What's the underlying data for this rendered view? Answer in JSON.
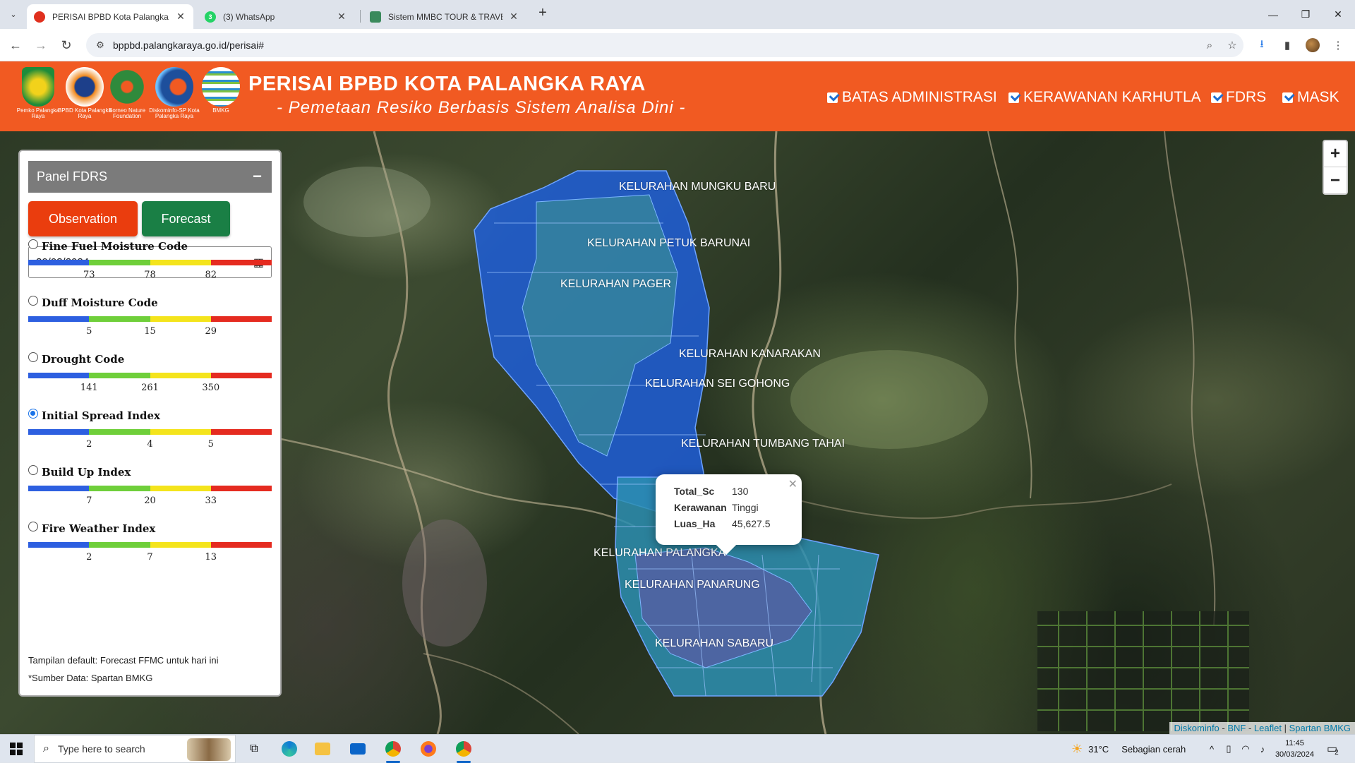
{
  "browser": {
    "tabs": [
      {
        "title": "PERISAI BPBD Kota Palangka Ra",
        "active": true
      },
      {
        "title": "(3) WhatsApp",
        "badge": "3",
        "active": false
      },
      {
        "title": "Sistem MMBC TOUR & TRAVEL",
        "active": false
      }
    ],
    "url": "bppbd.palangkaraya.go.id/perisai#"
  },
  "header": {
    "title": "PERISAI BPBD KOTA PALANGKA RAYA",
    "subtitle": "- Pemetaan Resiko Berbasis Sistem Analisa Dini -",
    "logos": [
      {
        "caption": "Pemko Palangka Raya",
        "color": "#1e8c3a"
      },
      {
        "caption": "BPBD Kota Palangka Raya",
        "color": "#f28a1f"
      },
      {
        "caption": "Borneo Nature Foundation",
        "color": "#2f8a3c"
      },
      {
        "caption": "Diskominfo-SP Kota Palangka Raya",
        "color": "#1d4f9c"
      },
      {
        "caption": "BMKG",
        "color": "#2a8fd0"
      }
    ],
    "layers": [
      {
        "label": "BATAS ADMINISTRASI",
        "checked": true
      },
      {
        "label": "KERAWANAN KARHUTLA",
        "checked": true
      },
      {
        "label": "FDRS",
        "checked": true
      },
      {
        "label": "MASK",
        "checked": true
      }
    ]
  },
  "panel": {
    "title": "Panel FDRS",
    "minimize": "−",
    "observation_label": "Observation",
    "forecast_label": "Forecast",
    "date": "30/03/2024",
    "indices": [
      {
        "name": "Fine Fuel Moisture Code",
        "ticks": [
          "73",
          "78",
          "82"
        ],
        "selected": false
      },
      {
        "name": "Duff Moisture Code",
        "ticks": [
          "5",
          "15",
          "29"
        ],
        "selected": false
      },
      {
        "name": "Drought Code",
        "ticks": [
          "141",
          "261",
          "350"
        ],
        "selected": false
      },
      {
        "name": "Initial Spread Index",
        "ticks": [
          "2",
          "4",
          "5"
        ],
        "selected": true
      },
      {
        "name": "Build Up Index",
        "ticks": [
          "7",
          "20",
          "33"
        ],
        "selected": false
      },
      {
        "name": "Fire Weather Index",
        "ticks": [
          "2",
          "7",
          "13"
        ],
        "selected": false
      }
    ],
    "scale_colors": [
      "#2d5fe0",
      "#6fcf3a",
      "#f4e41c",
      "#e52b20"
    ],
    "note_default": "Tampilan default: Forecast FFMC untuk hari ini",
    "note_source": "*Sumber Data: Spartan BMKG"
  },
  "map": {
    "kelurahan_labels": [
      "KELURAHAN MUNGKU BARU",
      "KELURAHAN PETUK BARUNAI",
      "KELURAHAN PAGER",
      "KELURAHAN KANARAKAN",
      "KELURAHAN SEI GOHONG",
      "KELURAHAN TUMBANG TAHAI",
      "KELURAHAN PALANGKA",
      "KELURAHAN PANARUNG",
      "KELURAHAN SABARU"
    ],
    "popup": {
      "rows": [
        {
          "key": "Total_Sc",
          "value": "130"
        },
        {
          "key": "Kerawanan",
          "value": "Tinggi"
        },
        {
          "key": "Luas_Ha",
          "value": "45,627.5"
        }
      ]
    },
    "zoom_in": "+",
    "zoom_out": "−",
    "attribution": {
      "diskominfo": "Diskominfo",
      "bnf": "BNF",
      "leaflet": "Leaflet",
      "spartan": "Spartan BMKG"
    }
  },
  "taskbar": {
    "search_placeholder": "Type here to search",
    "weather_temp": "31°C",
    "weather_desc": "Sebagian cerah",
    "time": "11:45",
    "date": "30/03/2024",
    "notifications": "2"
  }
}
